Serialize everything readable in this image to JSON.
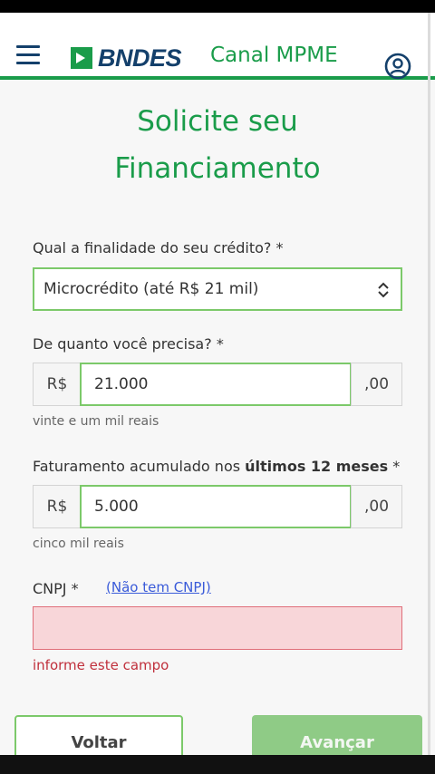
{
  "header": {
    "menu_icon": "hamburger-menu-icon",
    "logo_text": "BNDES",
    "canal": "Canal MPME",
    "account_icon": "account-circle-icon"
  },
  "title": {
    "line1": "Solicite seu",
    "line2": "Financiamento"
  },
  "form": {
    "finalidade": {
      "label": "Qual a finalidade do seu crédito? *",
      "selected": "Microcrédito (até R$ 21 mil)",
      "chevron_icon": "up-down-chevron-icon"
    },
    "valor": {
      "label": "De quanto você precisa? *",
      "prefix": "R$",
      "value": "21.000",
      "suffix": ",00",
      "helper": "vinte e um mil reais"
    },
    "faturamento": {
      "label_start": "Faturamento acumulado nos ",
      "label_bold": "últimos 12 meses",
      "label_end": " *",
      "prefix": "R$",
      "value": "5.000",
      "suffix": ",00",
      "helper": "cinco mil reais"
    },
    "cnpj": {
      "label": "CNPJ *",
      "link": "(Não tem CNPJ)",
      "value": "",
      "error": "informe este campo"
    }
  },
  "buttons": {
    "back": "Voltar",
    "next": "Avançar"
  },
  "colors": {
    "brand_green": "#1a9c4a",
    "brand_blue": "#14406b",
    "error_red": "#c0303c"
  }
}
